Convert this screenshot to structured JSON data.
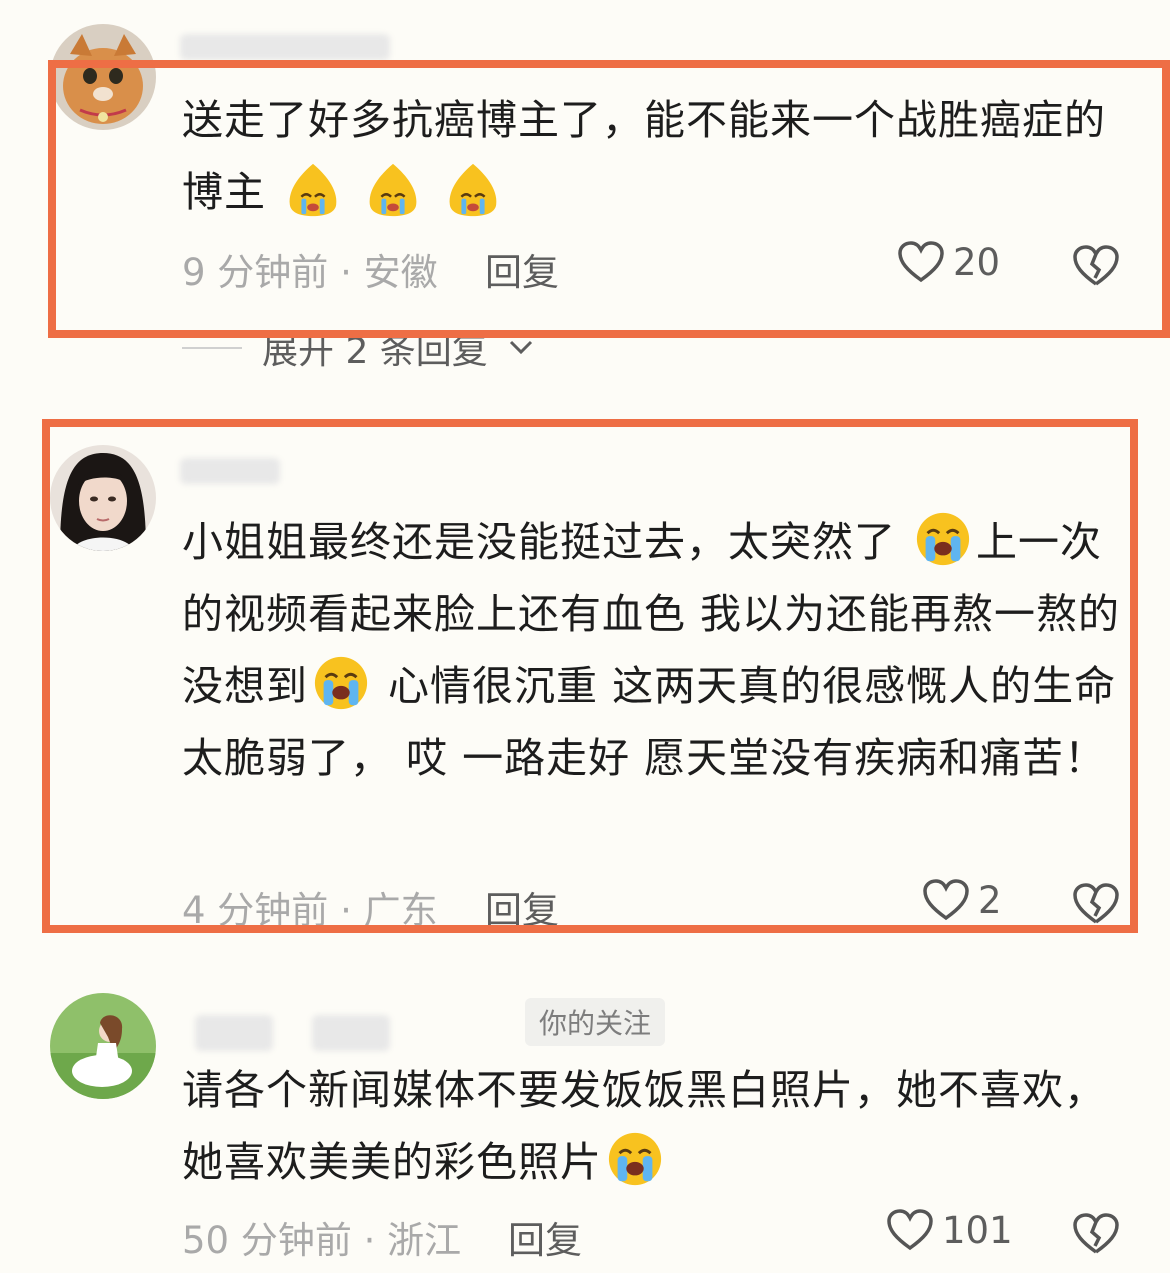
{
  "colors": {
    "highlight_border": "#ee6e45",
    "background": "#fdfcf7",
    "meta_text": "#a9a9a9",
    "action_text": "#5d5d5d"
  },
  "comments": [
    {
      "avatar": "cat-avatar",
      "text_parts": [
        "送走了好多抗癌博主了，能不能来一个战胜癌症的博主"
      ],
      "emoji_count": 3,
      "meta": "9 分钟前 · 安徽",
      "reply_label": "回复",
      "likes": "20",
      "expand_label": "展开 2 条回复"
    },
    {
      "avatar": "girl-portrait-avatar",
      "text_parts": [
        "小姐姐最终还是没能挺过去，太突然了",
        "上一次的视频看起来脸上还有血色 我以为还能再熬一熬的 没想到",
        " 心情很沉重 这两天真的很感慨人的生命太脆弱了， 哎 一路走好 愿天堂没有疾病和痛苦！"
      ],
      "meta": "4 分钟前 · 广东",
      "reply_label": "回复",
      "likes": "2"
    },
    {
      "avatar": "girl-on-grass-avatar",
      "follow_badge": "你的关注",
      "text_parts": [
        "请各个新闻媒体不要发饭饭黑白照片，她不喜欢，她喜欢美美的彩色照片"
      ],
      "meta": "50 分钟前 · 浙江",
      "reply_label": "回复",
      "likes": "101"
    }
  ]
}
